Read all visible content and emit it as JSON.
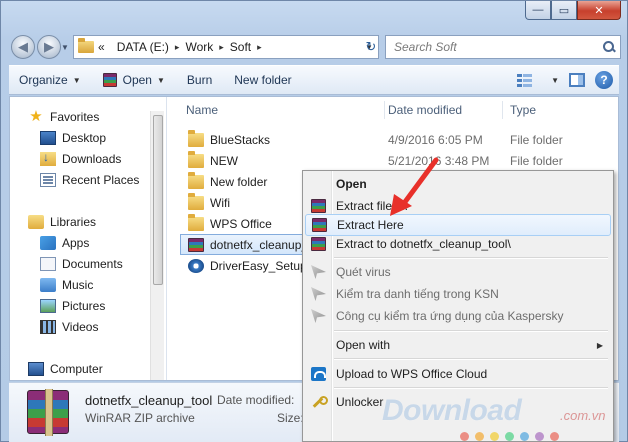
{
  "window": {
    "caption_buttons": [
      "minimize",
      "maximize",
      "close"
    ],
    "close_glyph": "✕",
    "min_glyph": "—",
    "max_glyph": "▭"
  },
  "nav": {
    "back_glyph": "◀",
    "forward_glyph": "▶",
    "history_glyph": "▼",
    "breadcrumb_prefix": "«",
    "breadcrumb": [
      "DATA (E:)",
      "Work",
      "Soft"
    ],
    "separator_glyph": "▸",
    "refresh_glyph": "↻",
    "search_placeholder": "Search Soft"
  },
  "toolbar": {
    "organize": "Organize",
    "open": "Open",
    "burn": "Burn",
    "new_folder": "New folder",
    "help_glyph": "?"
  },
  "sidebar": {
    "favorites": "Favorites",
    "desktop": "Desktop",
    "downloads": "Downloads",
    "recent": "Recent Places",
    "libraries": "Libraries",
    "apps": "Apps",
    "documents": "Documents",
    "music": "Music",
    "pictures": "Pictures",
    "videos": "Videos",
    "computer": "Computer"
  },
  "columns": {
    "name": "Name",
    "date": "Date modified",
    "type": "Type"
  },
  "files": [
    {
      "name": "BlueStacks",
      "date": "4/9/2016 6:05 PM",
      "type": "File folder",
      "icon": "folder"
    },
    {
      "name": "NEW",
      "date": "5/21/2016 3:48 PM",
      "type": "File folder",
      "icon": "folder"
    },
    {
      "name": "New folder",
      "date": "",
      "type": "",
      "icon": "folder"
    },
    {
      "name": "Wifi",
      "date": "",
      "type": "",
      "icon": "folder"
    },
    {
      "name": "WPS Office",
      "date": "",
      "type": "",
      "icon": "folder"
    },
    {
      "name": "dotnetfx_cleanup_",
      "date": "",
      "type": "",
      "icon": "rar-archive"
    },
    {
      "name": "DriverEasy_Setup",
      "date": "",
      "type": "",
      "icon": "driver-easy"
    }
  ],
  "details": {
    "name": "dotnetfx_cleanup_tool",
    "type": "WinRAR ZIP archive",
    "date_label": "Date modified:",
    "size_label": "Size:"
  },
  "context_menu": {
    "open": "Open",
    "extract_files": "Extract files...",
    "extract_here": "Extract Here",
    "extract_to": "Extract to dotnetfx_cleanup_tool\\",
    "quet_virus": "Quét virus",
    "ksn": "Kiểm tra danh tiếng trong KSN",
    "kaspersky": "Công cụ kiểm tra ứng dụng của Kaspersky",
    "open_with": "Open with",
    "wps_cloud": "Upload to WPS Office Cloud",
    "unlocker": "Unlocker",
    "submenu_glyph": "▶"
  },
  "watermark": {
    "text": "Download",
    "domain": ".com.vn"
  },
  "colors": {
    "annotation_arrow": "#e8302a",
    "hover_border": "#a8cff5",
    "selection_border": "#84acdd",
    "watermark_dots": [
      "#e84c3d",
      "#f39c12",
      "#f1c40f",
      "#2ecc71",
      "#3498db",
      "#9b59b6",
      "#e84c3d"
    ]
  }
}
